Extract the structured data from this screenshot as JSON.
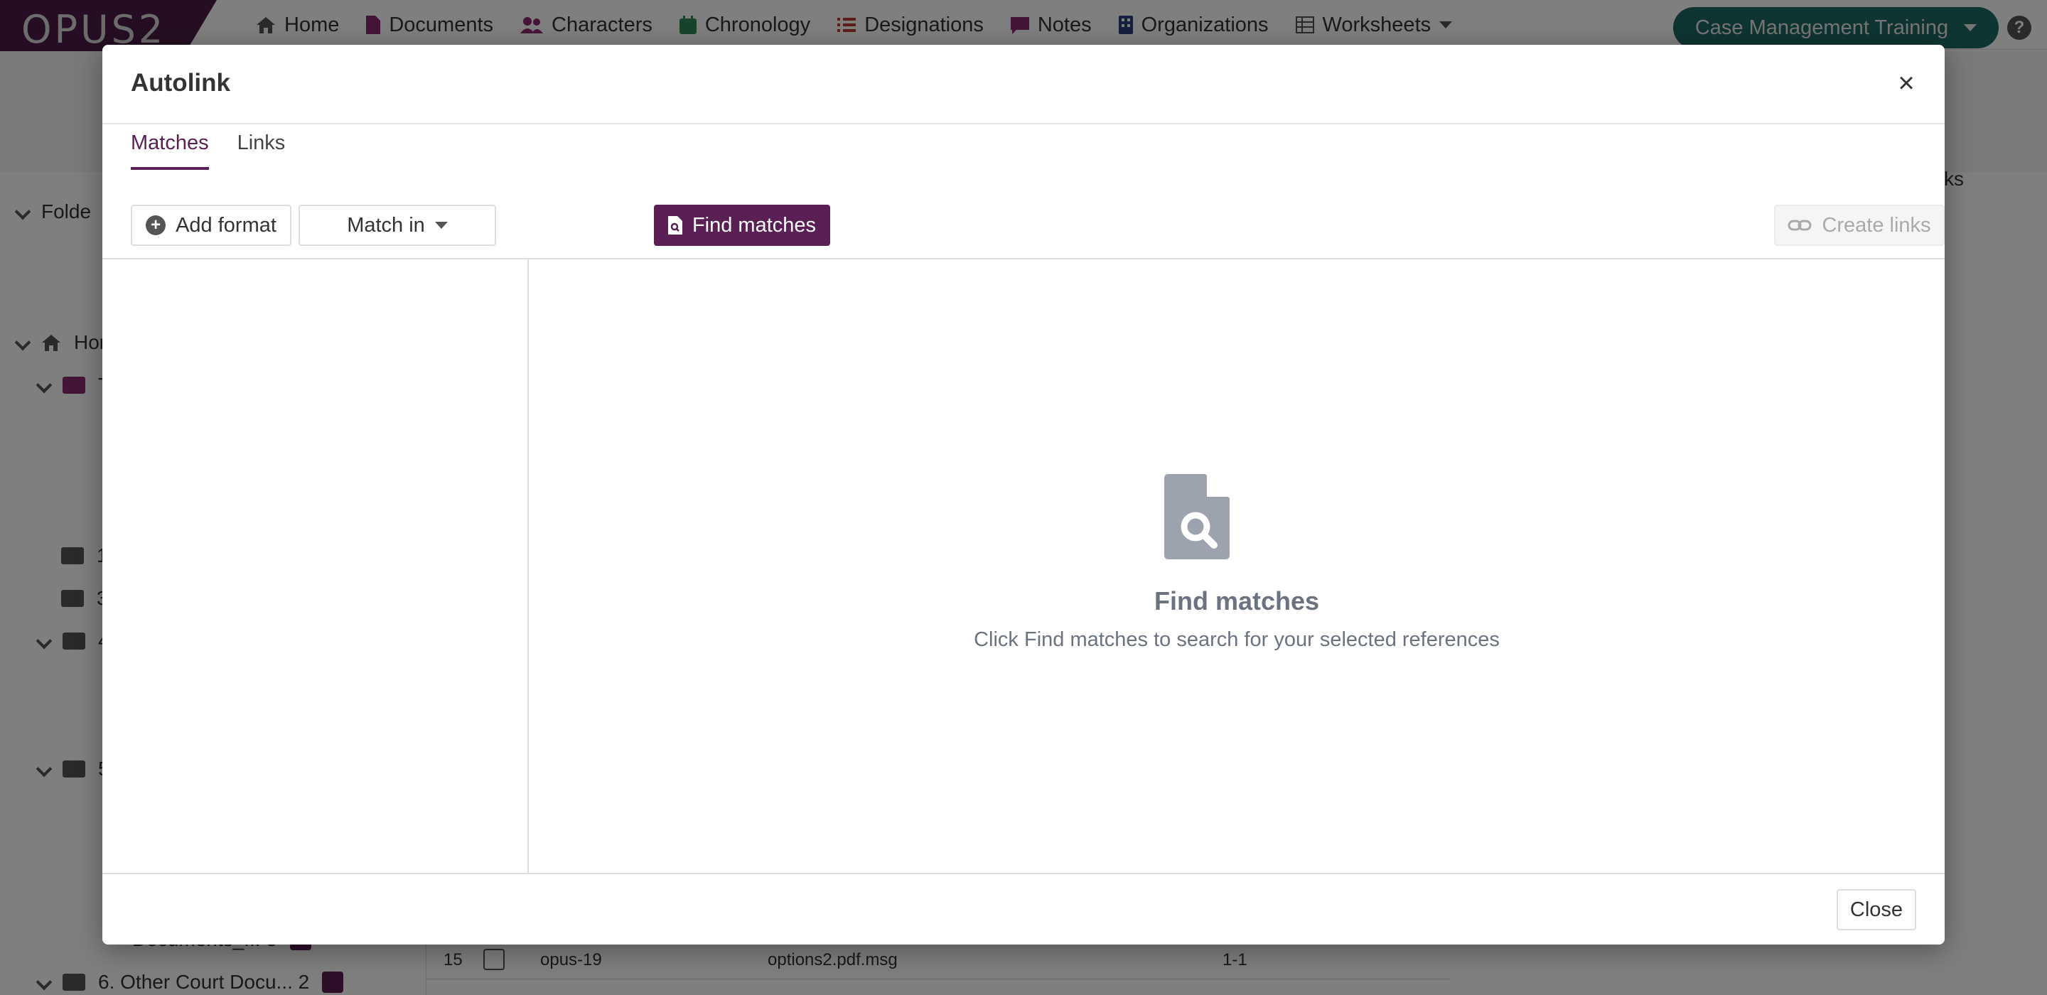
{
  "app": {
    "logo_text": "OPUS2",
    "nav": [
      {
        "label": "Home",
        "icon": "home-icon",
        "color": "#555555"
      },
      {
        "label": "Documents",
        "icon": "document-icon",
        "color": "#8b2a6e"
      },
      {
        "label": "Characters",
        "icon": "users-icon",
        "color": "#8b2a6e"
      },
      {
        "label": "Chronology",
        "icon": "calendar-icon",
        "color": "#2e8b57"
      },
      {
        "label": "Designations",
        "icon": "list-icon",
        "color": "#c0392b"
      },
      {
        "label": "Notes",
        "icon": "note-icon",
        "color": "#8b2a6e"
      },
      {
        "label": "Organizations",
        "icon": "building-icon",
        "color": "#2c3e80"
      },
      {
        "label": "Worksheets",
        "icon": "grid-icon",
        "color": "#555555"
      }
    ],
    "case_selector": "Case Management Training",
    "sidebar": {
      "header": "Folde",
      "rows": [
        {
          "label": "Hor"
        },
        {
          "label": "T"
        },
        {
          "label": "1"
        },
        {
          "label": "3"
        },
        {
          "label": "4"
        },
        {
          "label": "5"
        },
        {
          "label": "Documents_... 3"
        },
        {
          "label": "6. Other Court Docu... 2"
        }
      ]
    },
    "table_row": {
      "index": "15",
      "id": "opus-19",
      "file": "options2.pdf.msg",
      "pages": "1-1"
    },
    "right_fragment": "ks"
  },
  "modal": {
    "title": "Autolink",
    "close_symbol": "×",
    "tabs": [
      {
        "label": "Matches",
        "active": true
      },
      {
        "label": "Links",
        "active": false
      }
    ],
    "toolbar": {
      "add_format": "Add format",
      "match_in": "Match in",
      "find_matches": "Find matches",
      "create_links": "Create links"
    },
    "empty_state": {
      "title": "Find matches",
      "subtitle": "Click Find matches to search for your selected references"
    },
    "footer": {
      "close": "Close"
    }
  },
  "colors": {
    "brand": "#5a1f55",
    "case_button": "#1c6b64",
    "empty_text": "#6b7280"
  }
}
